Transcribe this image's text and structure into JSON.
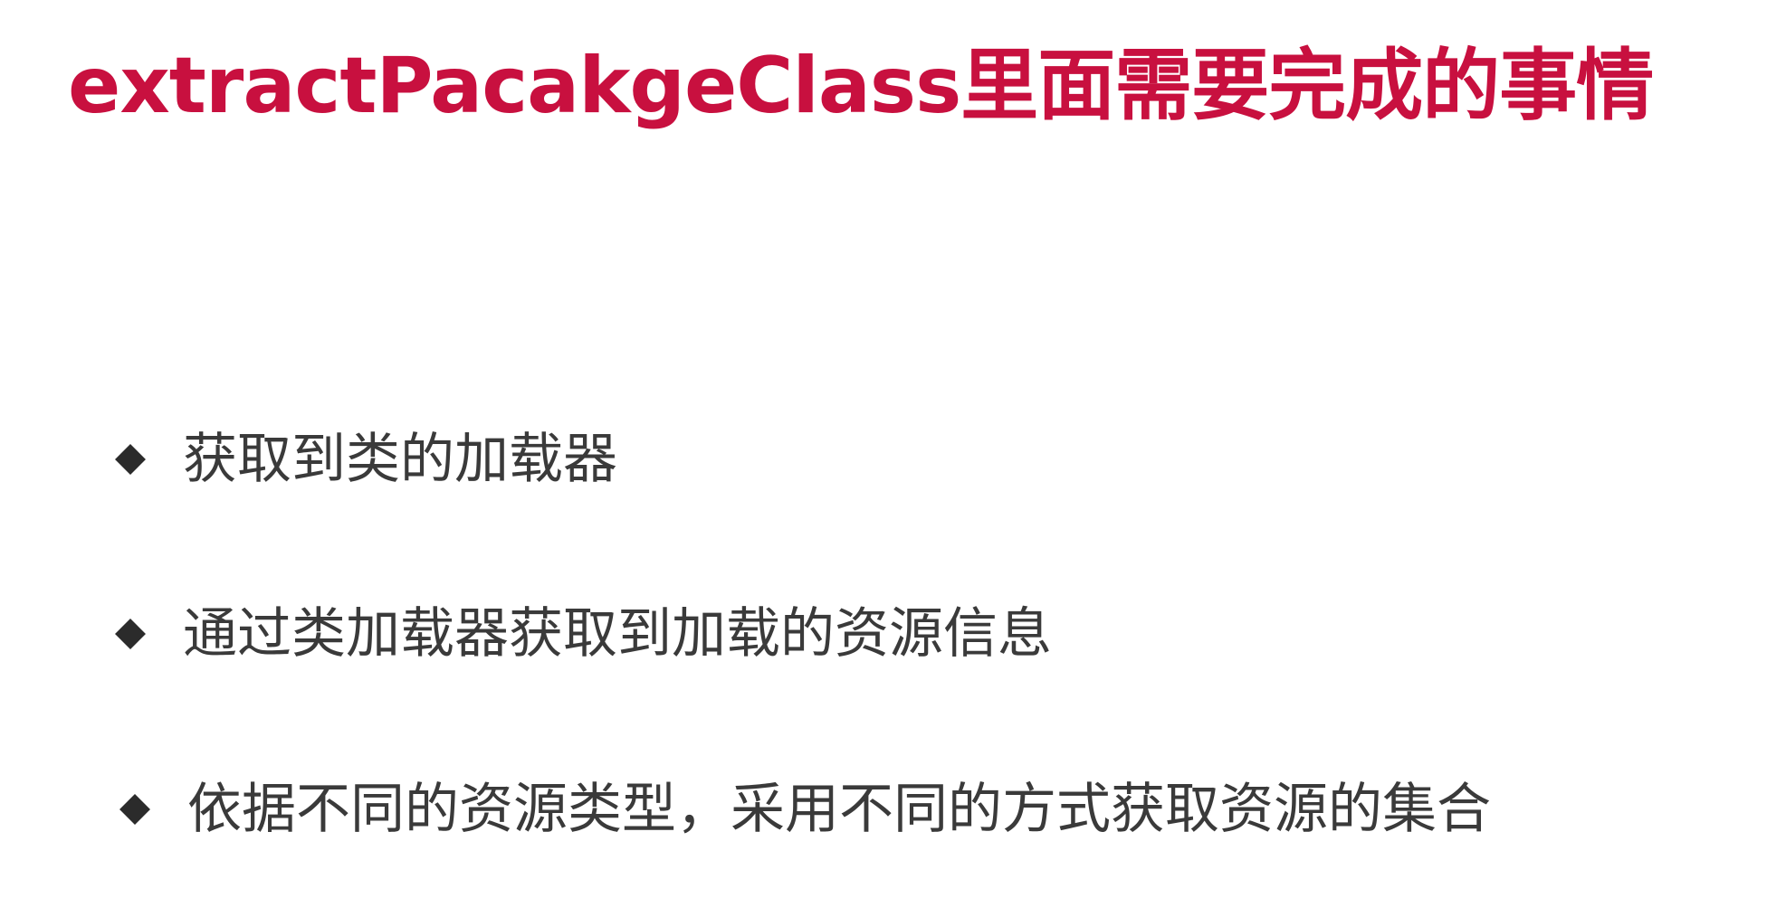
{
  "slide": {
    "title": "extractPacakgeClass里面需要完成的事情",
    "bullets": [
      {
        "icon": "diamond-bullet-icon",
        "text": "获取到类的加载器"
      },
      {
        "icon": "diamond-bullet-icon",
        "text": "通过类加载器获取到加载的资源信息"
      },
      {
        "icon": "diamond-bullet-icon",
        "text": "依据不同的资源类型，采用不同的方式获取资源的集合"
      }
    ],
    "colors": {
      "title": "#c8103f",
      "bullet_text": "#3a3a3a",
      "bullet_marker": "#2b2b2b",
      "background": "#ffffff"
    }
  }
}
